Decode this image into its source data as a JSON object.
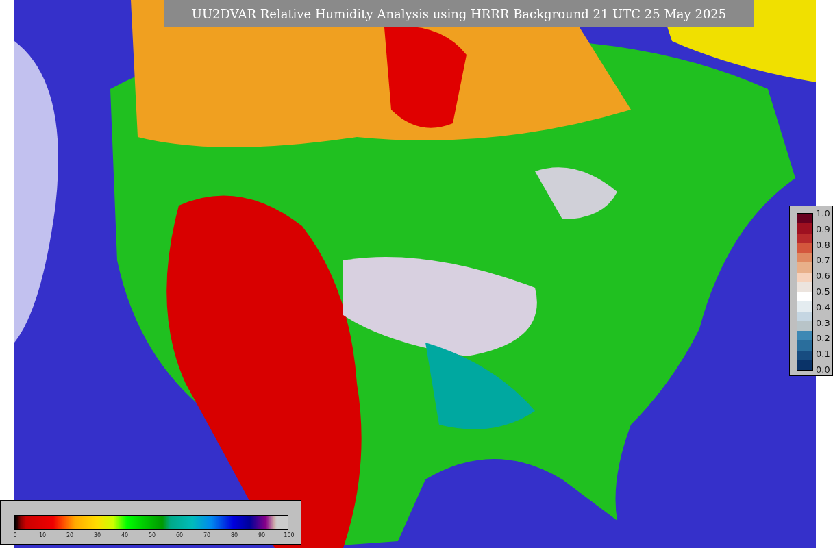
{
  "title": "UU2DVAR Relative Humidity Analysis using HRRR Background 21 UTC 25 May 2025",
  "humidity_colorbar": {
    "ticks": [
      "0",
      "10",
      "20",
      "30",
      "40",
      "50",
      "60",
      "70",
      "80",
      "90",
      "100"
    ]
  },
  "observation_colorbar": {
    "ticks": [
      "1.0",
      "0.9",
      "0.8",
      "0.7",
      "0.6",
      "0.5",
      "0.4",
      "0.3",
      "0.2",
      "0.1",
      "0.0"
    ]
  }
}
